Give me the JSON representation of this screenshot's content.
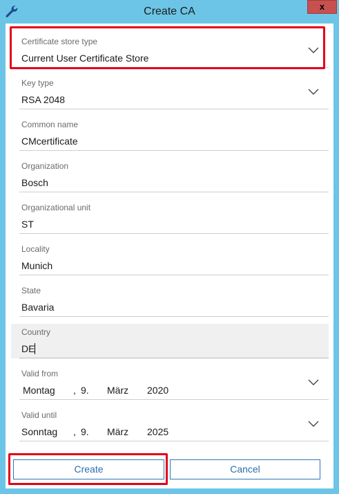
{
  "window": {
    "title": "Create CA",
    "close_label": "x"
  },
  "fields": {
    "store_type": {
      "label": "Certificate store type",
      "value": "Current User Certificate Store"
    },
    "key_type": {
      "label": "Key type",
      "value": "RSA 2048"
    },
    "common_name": {
      "label": "Common name",
      "value": "CMcertificate"
    },
    "organization": {
      "label": "Organization",
      "value": "Bosch"
    },
    "org_unit": {
      "label": "Organizational unit",
      "value": "ST"
    },
    "locality": {
      "label": "Locality",
      "value": "Munich"
    },
    "state": {
      "label": "State",
      "value": "Bavaria"
    },
    "country": {
      "label": "Country",
      "value": "DE"
    },
    "valid_from": {
      "label": "Valid from",
      "weekday": "Montag",
      "comma": ",",
      "day": "9.",
      "month": "März",
      "year": "2020"
    },
    "valid_until": {
      "label": "Valid until",
      "weekday": "Sonntag",
      "comma": ",",
      "day": "9.",
      "month": "März",
      "year": "2025"
    }
  },
  "buttons": {
    "create": "Create",
    "cancel": "Cancel"
  },
  "colors": {
    "titlebar": "#6cc5e6",
    "highlight": "#e2001a",
    "button_border": "#2a77b8",
    "close_button": "#c75050"
  }
}
